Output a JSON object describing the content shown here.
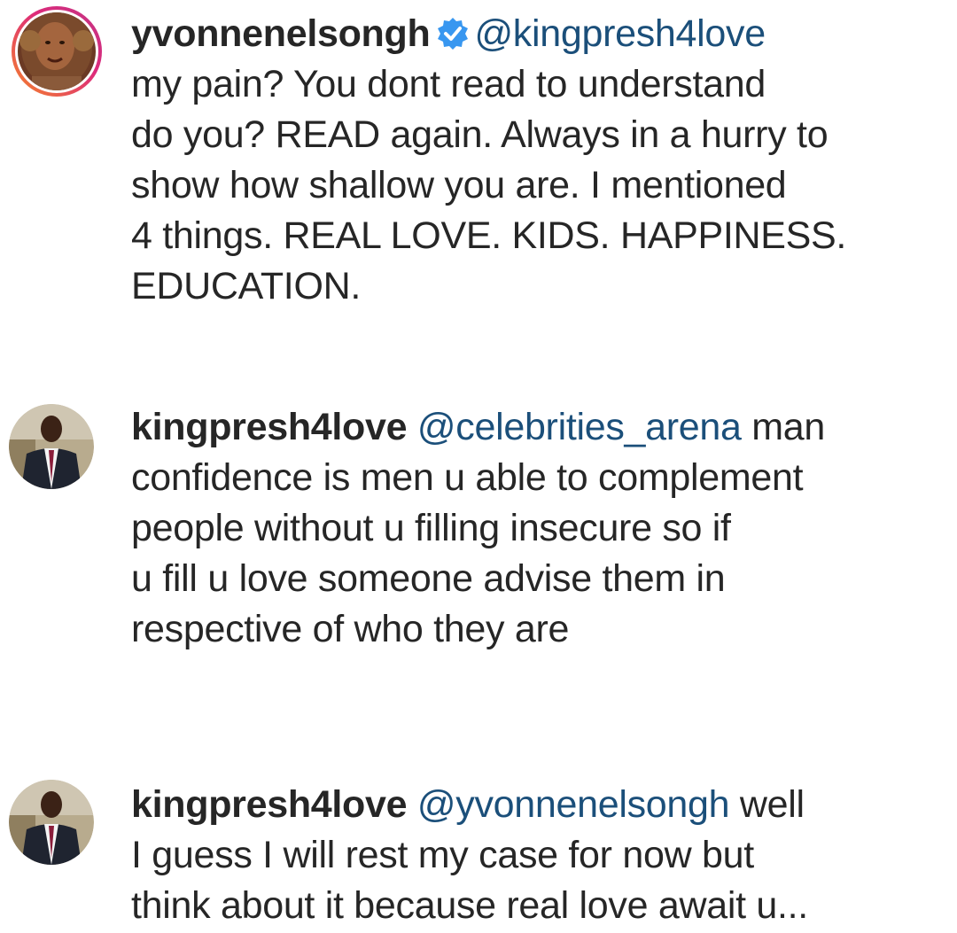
{
  "comments": [
    {
      "username": "yvonnenelsongh",
      "verified": true,
      "mention": "@kingpresh4love",
      "first_line_rest": "",
      "lines": [
        "my pain? You dont read to understand",
        "do you? READ again. Always in a hurry to",
        "show how shallow you are. I mentioned",
        "4 things. REAL LOVE. KIDS. HAPPINESS.",
        "EDUCATION."
      ]
    },
    {
      "username": "kingpresh4love",
      "verified": false,
      "mention": "@celebrities_arena",
      "first_line_rest": " man",
      "lines": [
        "confidence is men u able to complement",
        "people without u filling insecure so if",
        "u fill u love someone advise them in",
        "respective of who they are"
      ]
    },
    {
      "username": "kingpresh4love",
      "verified": false,
      "mention": "@yvonnenelsongh",
      "first_line_rest": " well",
      "lines": [
        "I guess I will rest my case for now but",
        "think about it because real love await u..."
      ]
    }
  ],
  "icons": {
    "verified": "verified-badge-icon",
    "avatar_woman": "avatar",
    "avatar_man": "avatar"
  },
  "colors": {
    "text": "#262626",
    "mention": "#1b4f7a",
    "verified": "#3897f0",
    "story_ring_start": "#f58529",
    "story_ring_end": "#dd2a7b"
  }
}
